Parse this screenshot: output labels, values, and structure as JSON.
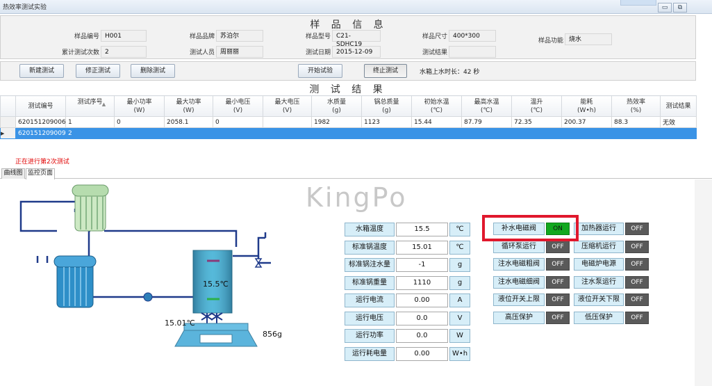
{
  "window": {
    "title": "热效率测试实验"
  },
  "colors": {
    "accent_selection": "#3a93e6",
    "status_red": "#e00000",
    "on_green": "#12a81f",
    "off_gray": "#5a5a5a",
    "highlight_red": "#e0182d"
  },
  "sample": {
    "title": "样 品 信 息",
    "fields": [
      {
        "label": "样品编号",
        "value": "H001"
      },
      {
        "label": "样品品牌",
        "value": "苏泊尔"
      },
      {
        "label": "样品型号",
        "value": "C21-SDHC19"
      },
      {
        "label": "样品尺寸",
        "value": "400*300"
      },
      {
        "label": "样品功能",
        "value": "烧水"
      },
      {
        "label": "累计测试次数",
        "value": "2"
      },
      {
        "label": "测试人员",
        "value": "周丽丽"
      },
      {
        "label": "测试日期",
        "value": "2015-12-09"
      },
      {
        "label": "测试结果",
        "value": ""
      }
    ]
  },
  "toolbar": {
    "new_test": "新建测试",
    "edit_test": "修正测试",
    "delete_test": "删除测试",
    "start_test": "开始试验",
    "stop_test": "终止测试",
    "water_time": "水箱上水时长：42 秒"
  },
  "results": {
    "title": "测 试 结 果",
    "columns": [
      {
        "name": "测试编号",
        "unit": ""
      },
      {
        "name": "测试序号",
        "unit": ""
      },
      {
        "name": "最小功率",
        "unit": "(W)"
      },
      {
        "name": "最大功率",
        "unit": "(W)"
      },
      {
        "name": "最小电压",
        "unit": "(V)"
      },
      {
        "name": "最大电压",
        "unit": "(V)"
      },
      {
        "name": "水质量",
        "unit": "(g)"
      },
      {
        "name": "锅总质量",
        "unit": "(g)"
      },
      {
        "name": "初始水温",
        "unit": "(℃)"
      },
      {
        "name": "最高水温",
        "unit": "(℃)"
      },
      {
        "name": "温升",
        "unit": "(℃)"
      },
      {
        "name": "能耗",
        "unit": "(W•h)"
      },
      {
        "name": "热效率",
        "unit": "(%)"
      },
      {
        "name": "测试结果",
        "unit": ""
      }
    ],
    "sort_indicator": "▲",
    "rows": [
      [
        "620151209006",
        "1",
        "0",
        "2058.1",
        "0",
        "",
        "1982",
        "1123",
        "15.44",
        "87.79",
        "72.35",
        "200.37",
        "88.3",
        "无效"
      ],
      [
        "620151209009",
        "2",
        "",
        "",
        "",
        "",
        "",
        "",
        "",
        "",
        "",
        "",
        "",
        ""
      ]
    ]
  },
  "status_text": "正在进行第2次测试",
  "tabs": [
    {
      "label": "曲线图"
    },
    {
      "label": "监控页面"
    }
  ],
  "watermark": "KingPo",
  "diagram": {
    "tank_temp": "15.5℃",
    "pot_temp": "15.01℃",
    "weight": "856g"
  },
  "readings": [
    {
      "label": "水箱温度",
      "value": "15.5",
      "unit": "℃"
    },
    {
      "label": "标准锅温度",
      "value": "15.01",
      "unit": "℃"
    },
    {
      "label": "标准锅注水量",
      "value": "-1",
      "unit": "g"
    },
    {
      "label": "标准锅重量",
      "value": "1110",
      "unit": "g"
    },
    {
      "label": "运行电流",
      "value": "0.00",
      "unit": "A"
    },
    {
      "label": "运行电压",
      "value": "0.0",
      "unit": "V"
    },
    {
      "label": "运行功率",
      "value": "0.0",
      "unit": "W"
    },
    {
      "label": "运行耗电量",
      "value": "0.00",
      "unit": "W•h"
    }
  ],
  "status_left": [
    {
      "label": "补水电磁阀",
      "state": "ON"
    },
    {
      "label": "循环泵运行",
      "state": "OFF"
    },
    {
      "label": "注水电磁粗阀",
      "state": "OFF"
    },
    {
      "label": "注水电磁细阀",
      "state": "OFF"
    },
    {
      "label": "液位开关上限",
      "state": "OFF"
    },
    {
      "label": "高压保护",
      "state": "OFF"
    }
  ],
  "status_right": [
    {
      "label": "加热器运行",
      "state": "OFF"
    },
    {
      "label": "压缩机运行",
      "state": "OFF"
    },
    {
      "label": "电磁炉电源",
      "state": "OFF"
    },
    {
      "label": "注水泵运行",
      "state": "OFF"
    },
    {
      "label": "液位开关下限",
      "state": "OFF"
    },
    {
      "label": "低压保护",
      "state": "OFF"
    }
  ]
}
